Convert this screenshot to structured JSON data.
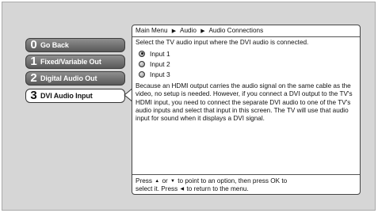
{
  "menu": {
    "items": [
      {
        "number": "0",
        "label": "Go Back"
      },
      {
        "number": "1",
        "label": "Fixed/Variable Out"
      },
      {
        "number": "2",
        "label": "Digital Audio Out"
      },
      {
        "number": "3",
        "label": "DVI Audio Input"
      }
    ],
    "selected_index": 3
  },
  "breadcrumb": {
    "items": [
      "Main Menu",
      "Audio",
      "Audio Connections"
    ],
    "separator": "▶"
  },
  "prompt": "Select the TV audio input where the DVI audio is connected.",
  "options": [
    {
      "label": "Input 1",
      "selected": true
    },
    {
      "label": "Input 2",
      "selected": false
    },
    {
      "label": "Input 3",
      "selected": false
    }
  ],
  "description": "Because an HDMI output carries the audio signal on the same cable as the video, no setup is needed. However, if you connect a DVI output to the TV's HDMI input, you need to connect the separate DVI audio to one of the TV's audio inputs and select that input in this screen. The TV will use that audio input for sound when it displays a DVI signal.",
  "footer": {
    "line1_a": "Press",
    "up_arrow": "▲",
    "line1_or": "or",
    "down_arrow": "▼",
    "line1_b": "to point to an option, then press OK to",
    "line2_a": "select it. Press",
    "left_arrow": "◀",
    "line2_b": "to return to the menu."
  },
  "colors": {
    "background": "#d6d6d6",
    "button": "#6e6e6e",
    "selected_button": "#ffffff",
    "panel": "#ffffff"
  }
}
